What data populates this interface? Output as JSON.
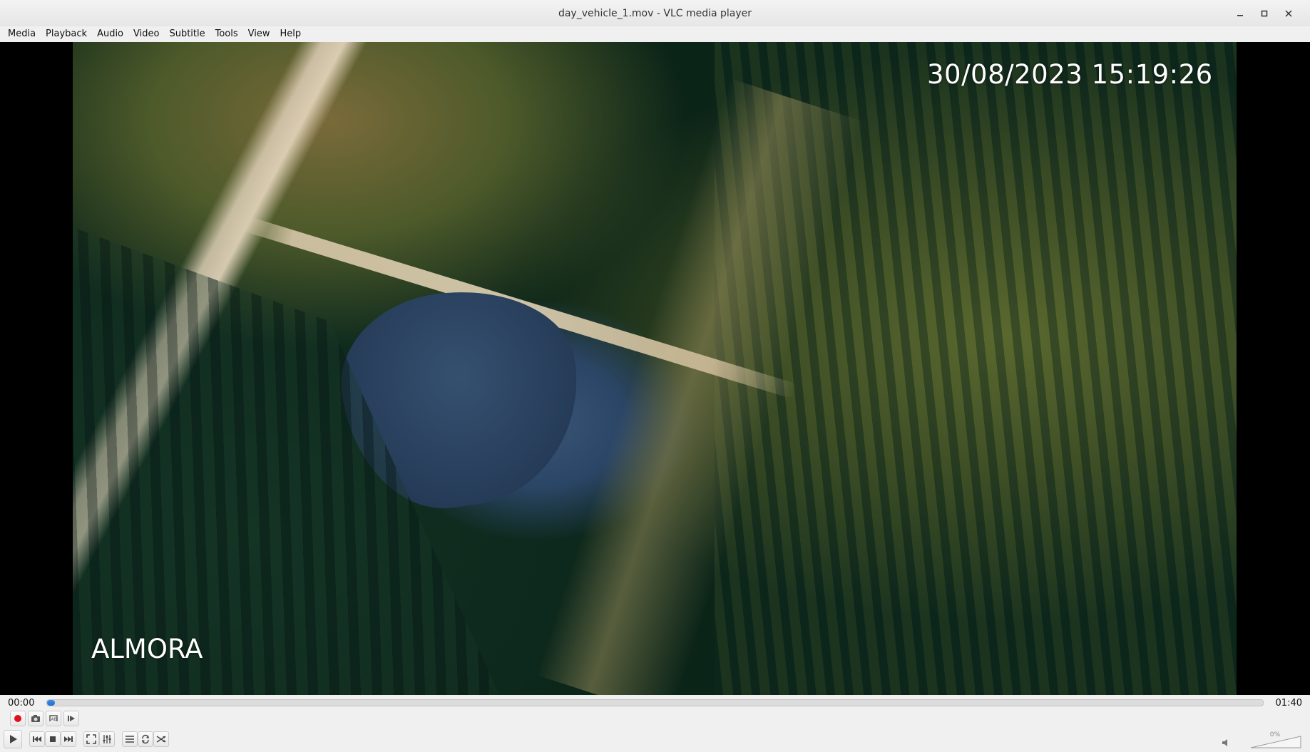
{
  "window": {
    "title": "day_vehicle_1.mov - VLC media player",
    "buttons": [
      "minimize-icon",
      "maximize-icon",
      "close-icon"
    ]
  },
  "menubar": {
    "items": [
      {
        "label": "Media"
      },
      {
        "label": "Playback"
      },
      {
        "label": "Audio"
      },
      {
        "label": "Video"
      },
      {
        "label": "Subtitle"
      },
      {
        "label": "Tools"
      },
      {
        "label": "View"
      },
      {
        "label": "Help"
      }
    ]
  },
  "video": {
    "overlay_datetime": "30/08/2023 15:19:26",
    "overlay_location": "ALMORA"
  },
  "seek": {
    "elapsed": "00:00",
    "total": "01:40",
    "progress_fraction": 0.005
  },
  "controls": {
    "row1": [
      "record-icon",
      "snapshot-icon",
      "ab-loop-icon",
      "frame-step-icon"
    ],
    "row2": [
      "play-icon",
      "previous-icon",
      "stop-icon",
      "next-icon",
      "fullscreen-icon",
      "extended-settings-icon",
      "playlist-icon",
      "loop-icon",
      "shuffle-icon"
    ],
    "accent_color": "#1f6fd0",
    "record_color": "#e0101c"
  },
  "volume": {
    "percent_label": "0%",
    "level_fraction": 0.0
  }
}
